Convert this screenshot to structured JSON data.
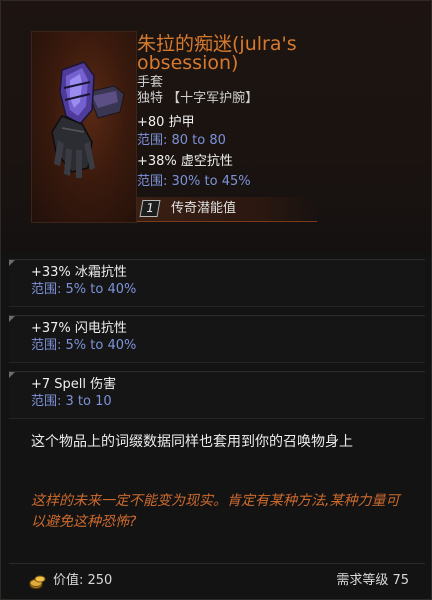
{
  "item": {
    "name": "朱拉的痴迷(julra's obsession)",
    "type": "手套",
    "rarity_line": "独特 【十字军护腕】",
    "stats": [
      {
        "text": "+80 护甲",
        "range": "范围: 80 to 80"
      },
      {
        "text": "+38% 虚空抗性",
        "range": "范围: 30% to 45%"
      }
    ],
    "tempered": {
      "count": "1",
      "label": "传奇潜能值"
    }
  },
  "affixes": [
    {
      "text": "+33% 冰霜抗性",
      "range": "范围: 5% to 40%"
    },
    {
      "text": "+37% 闪电抗性",
      "range": "范围: 5% to 40%"
    },
    {
      "text": "+7 Spell 伤害",
      "range": "范围: 3 to 10"
    }
  ],
  "note": "这个物品上的词缀数据同样也套用到你的召唤物身上",
  "flavor": "这样的未来一定不能变为现实。肯定有某种方法,某种力量可以避免这种恐怖?",
  "footer": {
    "value": "价值: 250",
    "requirement": "需求等级 75"
  },
  "colors": {
    "title": "#d77a2e",
    "range": "#7d93d8",
    "flavor": "#cc6a2e"
  },
  "icons": {
    "item": "gauntlet-icon",
    "coin": "gold-coin-icon"
  }
}
